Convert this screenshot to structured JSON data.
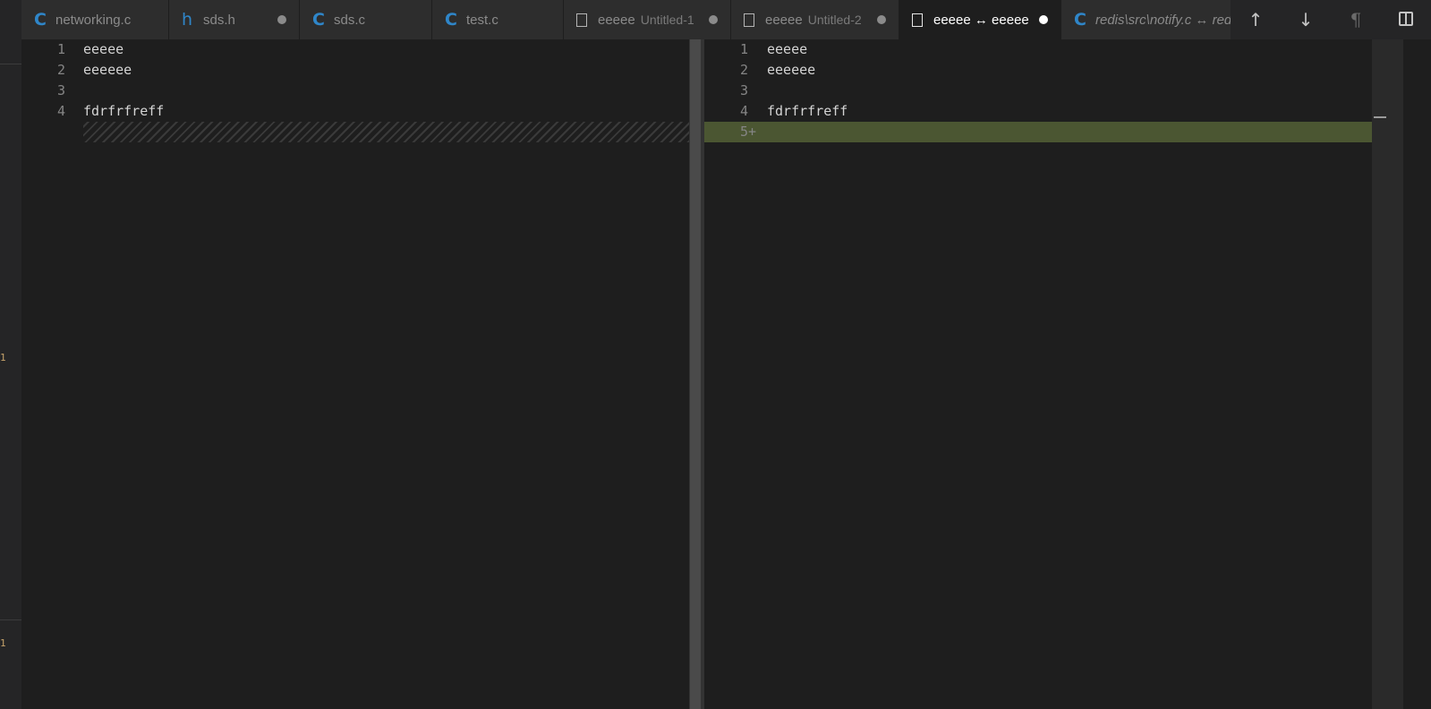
{
  "activity_strip": {
    "badges": [
      "1",
      "1"
    ]
  },
  "tabs": [
    {
      "icon": "c-icon",
      "label": "networking.c",
      "desc": "",
      "dirty": false,
      "active": false,
      "italic": false
    },
    {
      "icon": "h-icon",
      "label": "sds.h",
      "desc": "",
      "dirty": true,
      "active": false,
      "italic": false
    },
    {
      "icon": "c-icon",
      "label": "sds.c",
      "desc": "",
      "dirty": false,
      "active": false,
      "italic": false
    },
    {
      "icon": "c-icon",
      "label": "test.c",
      "desc": "",
      "dirty": false,
      "active": false,
      "italic": false
    },
    {
      "icon": "file-icon",
      "label": "eeeee",
      "desc": "Untitled-1",
      "dirty": true,
      "active": false,
      "italic": false
    },
    {
      "icon": "file-icon",
      "label": "eeeee",
      "desc": "Untitled-2",
      "dirty": true,
      "active": false,
      "italic": false
    },
    {
      "icon": "file-icon",
      "label": "eeeee ↔ eeeee",
      "desc": "",
      "dirty": true,
      "active": true,
      "italic": false
    },
    {
      "icon": "c-icon",
      "label": "redis\\src\\notify.c ↔ red",
      "desc": "",
      "dirty": false,
      "active": false,
      "italic": true
    }
  ],
  "toolbar": {
    "prev_change": "↑",
    "next_change": "↓",
    "whitespace": "¶",
    "split_editor": "split-icon"
  },
  "diff": {
    "left": {
      "line_numbers": [
        "1",
        "2",
        "3",
        "4"
      ],
      "lines": [
        "eeeee",
        "eeeeee",
        "",
        "fdrfrfreff"
      ]
    },
    "right": {
      "line_numbers": [
        "1",
        "2",
        "3",
        "4",
        "5+"
      ],
      "lines": [
        "eeeee",
        "eeeeee",
        "",
        "fdrfrfreff",
        ""
      ]
    },
    "colors": {
      "inserted_bg": "#4b5632",
      "editor_bg": "#1e1e1e"
    }
  }
}
